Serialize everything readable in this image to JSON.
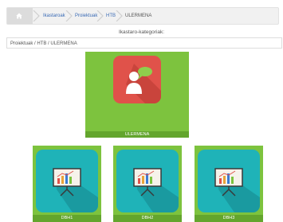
{
  "breadcrumb": {
    "items": [
      "Ikastaroak",
      "Proiektuak",
      "HTB",
      "ULERMENA"
    ]
  },
  "page": {
    "heading": "Ikastaro-kategoriak:",
    "path": "Proiektuak / HTB / ULERMENA"
  },
  "main_category": {
    "label": "ULERMENA",
    "icon": "speech-person-icon",
    "tile_color": "#e0524a"
  },
  "subcategories": [
    {
      "label": "DBH1",
      "icon": "presentation-chart-icon"
    },
    {
      "label": "DBH2",
      "icon": "presentation-chart-icon"
    },
    {
      "label": "DBH3",
      "icon": "presentation-chart-icon"
    }
  ],
  "colors": {
    "card_green": "#7dc33e",
    "label_green": "#63a52d",
    "tile_teal": "#1fb3b8"
  }
}
